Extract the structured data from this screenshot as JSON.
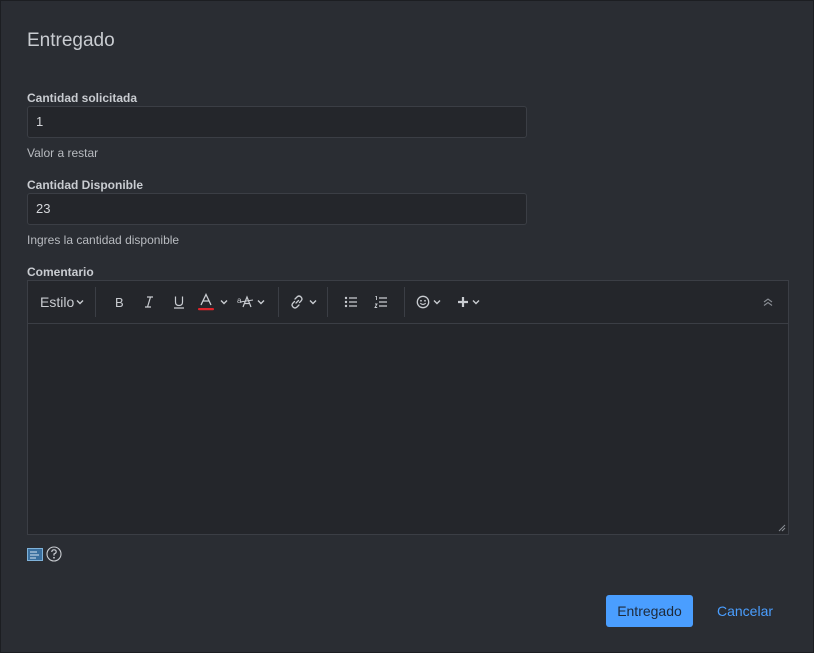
{
  "dialog": {
    "title": "Entregado"
  },
  "fields": {
    "requested": {
      "label": "Cantidad solicitada",
      "value": "1",
      "help": "Valor a restar"
    },
    "available": {
      "label": "Cantidad Disponible",
      "value": "23",
      "help": "Ingres la cantidad disponible"
    },
    "comment": {
      "label": "Comentario"
    }
  },
  "toolbar": {
    "style_label": "Estilo",
    "icons": [
      "bold-icon",
      "italic-icon",
      "underline-icon",
      "font-color-icon",
      "font-size-icon",
      "link-icon",
      "bullet-list-icon",
      "numbered-list-icon",
      "emoji-icon",
      "plus-icon",
      "collapse-icon"
    ],
    "font_color_accent": "#e0242b"
  },
  "actions": {
    "submit_label": "Entregado",
    "cancel_label": "Cancelar"
  },
  "colors": {
    "primary": "#4a9eff",
    "background": "#2a2d33",
    "input_background": "#24262b"
  }
}
